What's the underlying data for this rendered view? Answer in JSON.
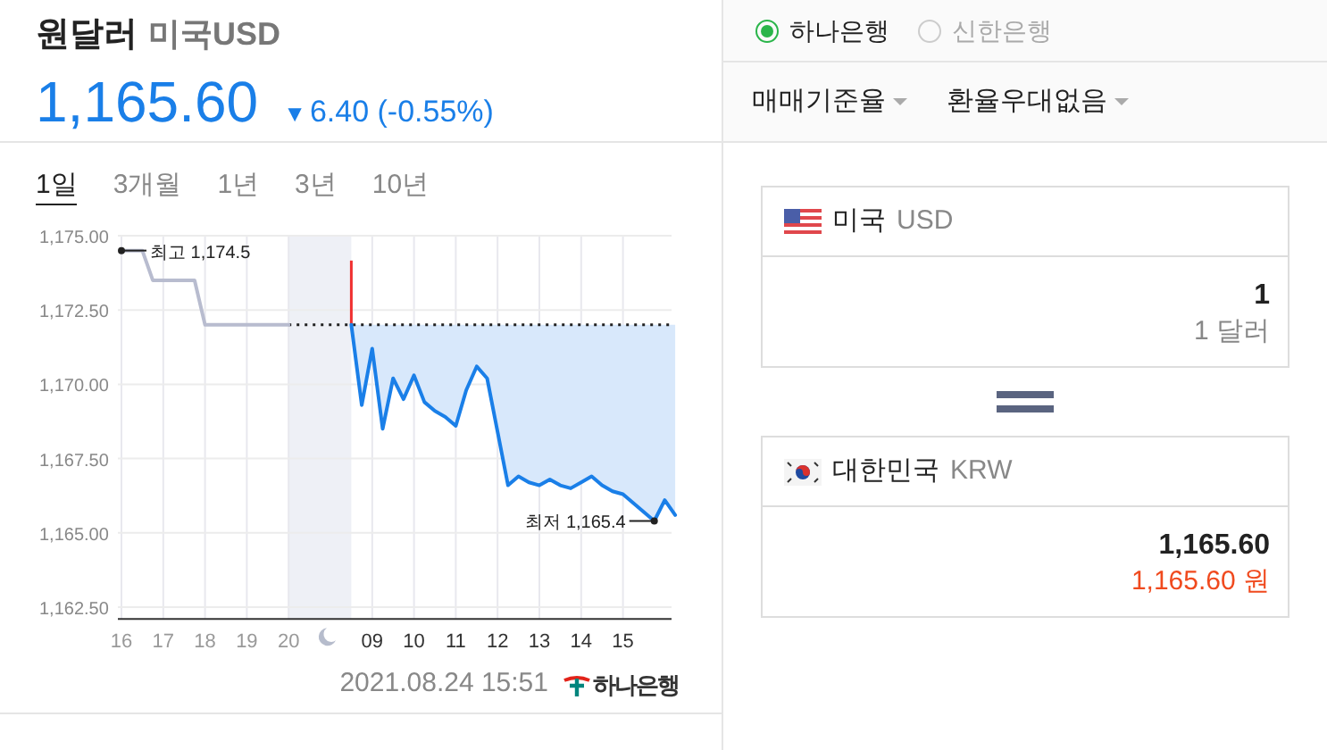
{
  "header": {
    "title": "원달러",
    "subtitle": "미국USD",
    "price": "1,165.60",
    "arrow": "▼",
    "change": "6.40",
    "change_percent": "(-0.55%)"
  },
  "period_tabs": [
    {
      "label": "1일",
      "selected": true
    },
    {
      "label": "3개월",
      "selected": false
    },
    {
      "label": "1년",
      "selected": false
    },
    {
      "label": "3년",
      "selected": false
    },
    {
      "label": "10년",
      "selected": false
    }
  ],
  "chart": {
    "chart_data": {
      "type": "line",
      "categories": [
        "16",
        null,
        null,
        null,
        "17",
        null,
        null,
        null,
        "18",
        null,
        null,
        null,
        "19",
        null,
        null,
        null,
        "20",
        null,
        null,
        null,
        null,
        null,
        null,
        null,
        "09",
        null,
        null,
        null,
        "10",
        null,
        null,
        null,
        "11",
        null,
        null,
        null,
        "12",
        null,
        null,
        null,
        "13",
        null,
        null,
        null,
        "14",
        null,
        null,
        null,
        "15",
        null,
        null,
        null,
        null,
        null
      ],
      "series": [
        {
          "color": "#b8bccf",
          "values": [
            1174.5,
            1174.5,
            1174.5,
            1173.5,
            1173.5,
            1173.5,
            1173.5,
            1173.5,
            1172,
            1172,
            1172,
            1172,
            1172,
            1172,
            1172,
            1172,
            1172,
            null,
            null,
            null,
            null,
            null,
            null,
            null,
            null,
            null,
            null,
            null,
            null,
            null,
            null,
            null,
            null,
            null,
            null,
            null,
            null,
            null,
            null,
            null,
            null,
            null,
            null,
            null,
            null,
            null,
            null,
            null,
            null,
            null,
            null,
            null,
            null,
            null
          ]
        },
        {
          "color": "#1a7fe8",
          "values": [
            null,
            null,
            null,
            null,
            null,
            null,
            null,
            null,
            null,
            null,
            null,
            null,
            null,
            null,
            null,
            null,
            null,
            null,
            null,
            null,
            null,
            null,
            1172,
            1169.3,
            1171.2,
            1168.5,
            1170.2,
            1169.5,
            1170.3,
            1169.4,
            1169.1,
            1168.9,
            1168.6,
            1169.8,
            1170.6,
            1170.2,
            1168.4,
            1166.6,
            1166.9,
            1166.7,
            1166.6,
            1166.8,
            1166.6,
            1166.5,
            1166.7,
            1166.9,
            1166.6,
            1166.4,
            1166.3,
            1166,
            1165.7,
            1165.4,
            1166.1,
            1165.6
          ]
        }
      ],
      "ylim": [
        1162.1,
        1175
      ],
      "grid": true,
      "ref_lines": [
        {
          "value": 1172,
          "axis": "y"
        }
      ],
      "yticks": [
        {
          "value": 1162.5,
          "label": "1,162.50"
        },
        {
          "value": 1165,
          "label": "1,165.00"
        },
        {
          "value": 1167.5,
          "label": "1,167.50"
        },
        {
          "value": 1170,
          "label": "1,170.00"
        },
        {
          "value": 1172.5,
          "label": "1,172.50"
        },
        {
          "value": 1175,
          "label": "1,175.00"
        }
      ],
      "annotations": [
        "최고 1,174.5",
        "최저 1,165.4"
      ]
    }
  },
  "timestamp": "2021.08.24 15:51",
  "bank_logo_text": "하나은행",
  "banks": [
    {
      "label": "하나은행",
      "selected": true
    },
    {
      "label": "신한은행",
      "selected": false
    }
  ],
  "dropdowns": [
    {
      "label": "매매기준율"
    },
    {
      "label": "환율우대없음"
    }
  ],
  "converter": [
    {
      "kind": "us",
      "country": "미국",
      "code": "USD",
      "amount": "1",
      "amount_text": "1 달러",
      "accent": false
    },
    {
      "kind": "kr",
      "country": "대한민국",
      "code": "KRW",
      "amount": "1,165.60",
      "amount_text": "1,165.60 원",
      "accent": true
    }
  ]
}
